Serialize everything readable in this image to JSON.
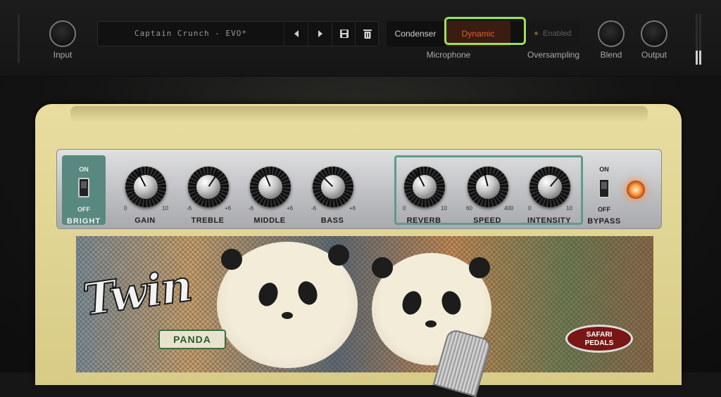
{
  "topbar": {
    "input_label": "Input",
    "preset_name": "Captain Crunch - EVO*",
    "mic_options": [
      "Condenser",
      "Dynamic"
    ],
    "mic_selected": "Dynamic",
    "mic_label": "Microphone",
    "oversampling_button": "Enabled",
    "oversampling_label": "Oversampling",
    "blend_label": "Blend",
    "output_label": "Output"
  },
  "amp": {
    "bright": {
      "on": "ON",
      "off": "OFF",
      "label": "BRIGHT"
    },
    "bypass": {
      "on": "ON",
      "off": "OFF",
      "label": "BYPASS"
    },
    "knobs": [
      {
        "label": "GAIN",
        "min": "0",
        "max": "10",
        "value": 4
      },
      {
        "label": "TREBLE",
        "min": "-6",
        "max": "+6",
        "value": 1.5
      },
      {
        "label": "MIDDLE",
        "min": "-6",
        "max": "+6",
        "value": -1
      },
      {
        "label": "BASS",
        "min": "-6",
        "max": "+6",
        "value": -2
      },
      {
        "label": "REVERB",
        "min": "0",
        "max": "10",
        "value": 4
      },
      {
        "label": "SPEED",
        "min": "60",
        "max": "400",
        "value": 212
      },
      {
        "label": "INTENSITY",
        "min": "0",
        "max": "10",
        "value": 6.5
      }
    ],
    "logo": "Twin",
    "badge": "PANDA",
    "brand_line1": "SAFARI",
    "brand_line2": "PEDALS"
  },
  "colors": {
    "accent_highlight": "#9fe05a",
    "dynamic_text": "#e0612a",
    "panel_teal": "#58887f"
  }
}
